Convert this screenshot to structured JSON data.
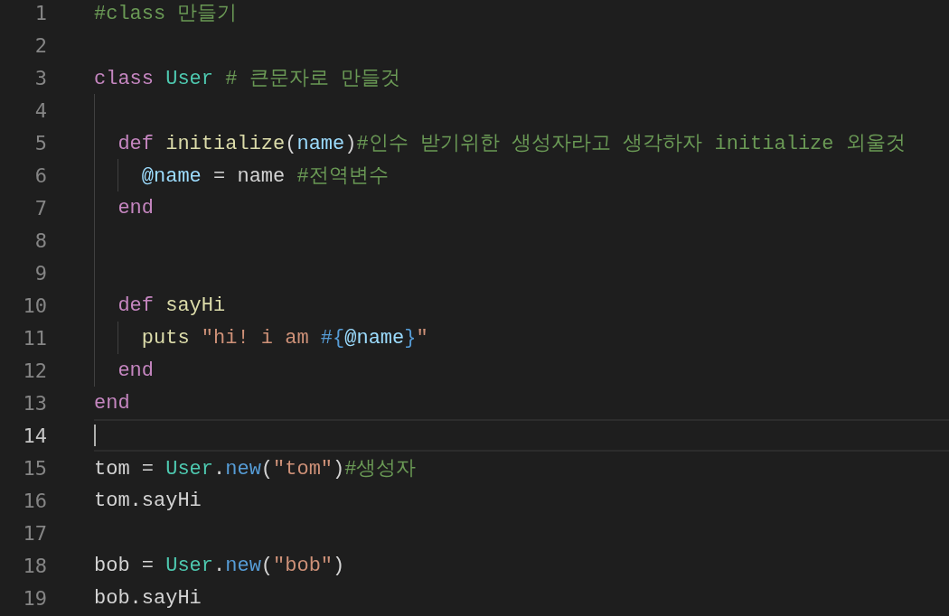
{
  "editor": {
    "lines": [
      {
        "number": "1",
        "current": false,
        "tokens": [
          {
            "t": "#class 만들기",
            "kind": "comment"
          }
        ]
      },
      {
        "number": "2",
        "current": false
      },
      {
        "number": "3",
        "current": false,
        "tokens": [
          {
            "t": "class ",
            "kind": "keyword"
          },
          {
            "t": "User",
            "kind": "type"
          },
          {
            "t": " # 큰문자로 만들것",
            "kind": "comment"
          }
        ]
      },
      {
        "number": "4",
        "current": false
      },
      {
        "number": "5",
        "current": false,
        "tokens": [
          {
            "t": "  def ",
            "kind": "keyword"
          },
          {
            "t": "initialize",
            "kind": "function"
          },
          {
            "t": "(",
            "kind": "plain"
          },
          {
            "t": "name",
            "kind": "variable"
          },
          {
            "t": ")",
            "kind": "plain"
          },
          {
            "t": "#인수 받기위한 생성자라고 생각하자 initialize 외울것",
            "kind": "comment"
          }
        ]
      },
      {
        "number": "6",
        "current": false,
        "tokens": [
          {
            "t": "    @name",
            "kind": "variable"
          },
          {
            "t": " = name ",
            "kind": "plain"
          },
          {
            "t": "#전역변수",
            "kind": "comment"
          }
        ]
      },
      {
        "number": "7",
        "current": false,
        "tokens": [
          {
            "t": "  end",
            "kind": "keyword"
          }
        ]
      },
      {
        "number": "8",
        "current": false
      },
      {
        "number": "9",
        "current": false
      },
      {
        "number": "10",
        "current": false,
        "tokens": [
          {
            "t": "  def ",
            "kind": "keyword"
          },
          {
            "t": "sayHi",
            "kind": "function"
          }
        ]
      },
      {
        "number": "11",
        "current": false,
        "tokens": [
          {
            "t": "    puts ",
            "kind": "function"
          },
          {
            "t": "\"hi! i am ",
            "kind": "string"
          },
          {
            "t": "#{",
            "kind": "special"
          },
          {
            "t": "@name",
            "kind": "variable"
          },
          {
            "t": "}",
            "kind": "special"
          },
          {
            "t": "\"",
            "kind": "string"
          }
        ]
      },
      {
        "number": "12",
        "current": false,
        "tokens": [
          {
            "t": "  end",
            "kind": "keyword"
          }
        ]
      },
      {
        "number": "13",
        "current": false,
        "tokens": [
          {
            "t": "end",
            "kind": "keyword"
          }
        ]
      },
      {
        "number": "14",
        "current": true
      },
      {
        "number": "15",
        "current": false,
        "tokens": [
          {
            "t": "tom = ",
            "kind": "plain"
          },
          {
            "t": "User",
            "kind": "type"
          },
          {
            "t": ".",
            "kind": "plain"
          },
          {
            "t": "new",
            "kind": "special"
          },
          {
            "t": "(",
            "kind": "plain"
          },
          {
            "t": "\"tom\"",
            "kind": "string"
          },
          {
            "t": ")",
            "kind": "plain"
          },
          {
            "t": "#생성자",
            "kind": "comment"
          }
        ]
      },
      {
        "number": "16",
        "current": false,
        "tokens": [
          {
            "t": "tom.sayHi",
            "kind": "plain"
          }
        ]
      },
      {
        "number": "17",
        "current": false
      },
      {
        "number": "18",
        "current": false,
        "tokens": [
          {
            "t": "bob = ",
            "kind": "plain"
          },
          {
            "t": "User",
            "kind": "type"
          },
          {
            "t": ".",
            "kind": "plain"
          },
          {
            "t": "new",
            "kind": "special"
          },
          {
            "t": "(",
            "kind": "plain"
          },
          {
            "t": "\"bob\"",
            "kind": "string"
          },
          {
            "t": ")",
            "kind": "plain"
          }
        ]
      },
      {
        "number": "19",
        "current": false,
        "tokens": [
          {
            "t": "bob.sayHi",
            "kind": "plain"
          }
        ]
      }
    ]
  }
}
